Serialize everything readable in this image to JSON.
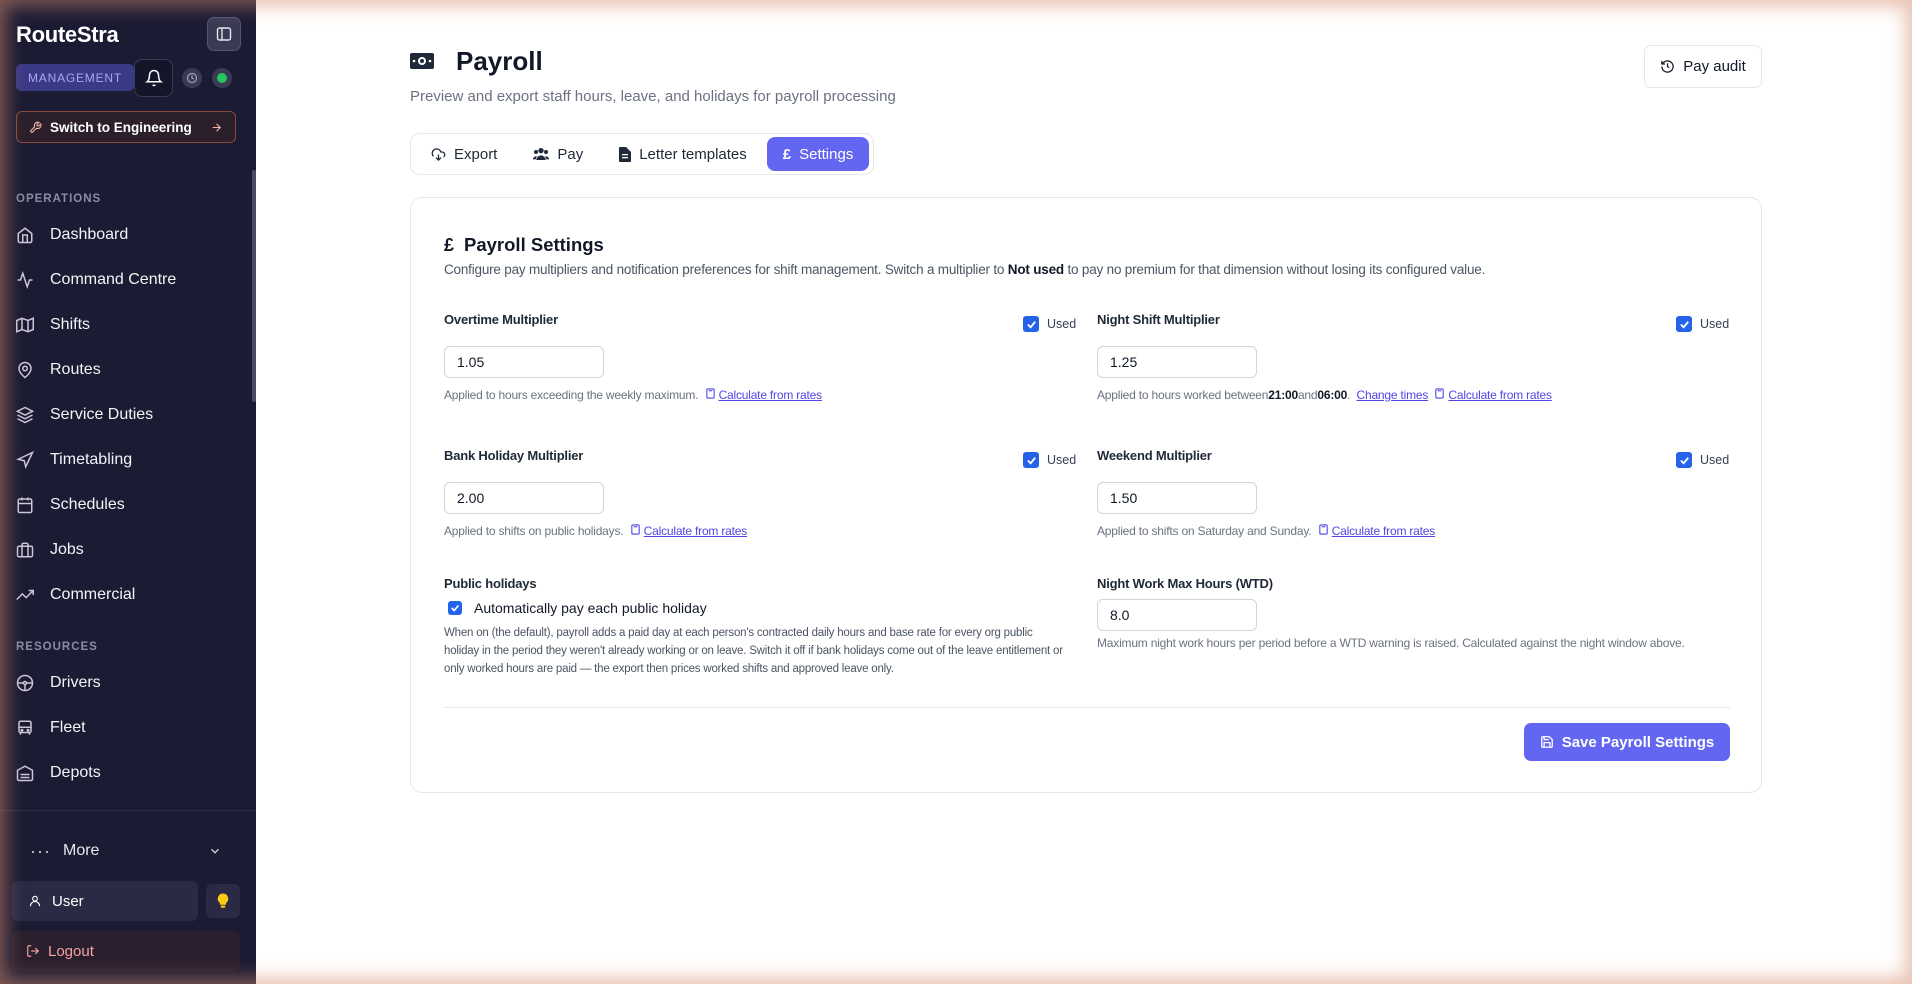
{
  "app": {
    "brand": "RouteStra",
    "role_badge": "MANAGEMENT"
  },
  "sidebar": {
    "switch_label": "Switch to Engineering",
    "sections": [
      {
        "label": "OPERATIONS"
      },
      {
        "label": "RESOURCES"
      }
    ],
    "items": [
      {
        "label": "Dashboard",
        "icon": "home-icon"
      },
      {
        "label": "Command Centre",
        "icon": "activity-icon"
      },
      {
        "label": "Shifts",
        "icon": "map-icon"
      },
      {
        "label": "Routes",
        "icon": "map-pin-icon"
      },
      {
        "label": "Service Duties",
        "icon": "layers-icon"
      },
      {
        "label": "Timetabling",
        "icon": "navigation-icon"
      },
      {
        "label": "Schedules",
        "icon": "calendar-icon"
      },
      {
        "label": "Jobs",
        "icon": "briefcase-icon"
      },
      {
        "label": "Commercial",
        "icon": "trending-up-icon"
      },
      {
        "label": "Drivers",
        "icon": "steering-wheel-icon"
      },
      {
        "label": "Fleet",
        "icon": "bus-icon"
      },
      {
        "label": "Depots",
        "icon": "warehouse-icon"
      }
    ],
    "more_label": "More",
    "user_label": "User",
    "logout_label": "Logout"
  },
  "header": {
    "title": "Payroll",
    "subtitle": "Preview and export staff hours, leave, and holidays for payroll processing",
    "audit_label": "Pay audit"
  },
  "tabs": [
    {
      "label": "Export",
      "icon": "cloud-download-icon"
    },
    {
      "label": "Pay",
      "icon": "users-icon"
    },
    {
      "label": "Letter templates",
      "icon": "file-icon"
    },
    {
      "label": "Settings",
      "icon": "pound-icon",
      "active": true
    }
  ],
  "settings": {
    "title": "Payroll Settings",
    "desc_before": "Configure pay multipliers and notification preferences for shift management. Switch a multiplier to ",
    "desc_bold": "Not used",
    "desc_after": " to pay no premium for that dimension without losing its configured value.",
    "used_label": "Used",
    "calc_label": "Calculate from rates",
    "overtime": {
      "label": "Overtime Multiplier",
      "value": "1.05",
      "used": true,
      "help": "Applied to hours exceeding the weekly maximum."
    },
    "night_shift": {
      "label": "Night Shift Multiplier",
      "value": "1.25",
      "used": true,
      "help_before": "Applied to hours worked between ",
      "start": "21:00",
      "and": " and ",
      "end": "06:00",
      "help_after": ".",
      "change_times": "Change times"
    },
    "bank_holiday": {
      "label": "Bank Holiday Multiplier",
      "value": "2.00",
      "used": true,
      "help": "Applied to shifts on public holidays."
    },
    "weekend": {
      "label": "Weekend Multiplier",
      "value": "1.50",
      "used": true,
      "help": "Applied to shifts on Saturday and Sunday."
    },
    "public_holidays": {
      "label": "Public holidays",
      "checkbox_label": "Automatically pay each public holiday",
      "checked": true,
      "help": "When on (the default), payroll adds a paid day at each person's contracted daily hours and base rate for every org public holiday in the period they weren't already working or on leave. Switch it off if bank holidays come out of the leave entitlement or only worked hours are paid — the export then prices worked shifts and approved leave only."
    },
    "night_work": {
      "label": "Night Work Max Hours (WTD)",
      "value": "8.0",
      "help": "Maximum night work hours per period before a WTD warning is raised. Calculated against the night window above."
    },
    "save_label": "Save Payroll Settings"
  },
  "colors": {
    "accent": "#6366f1",
    "sidebar_bg": "#1b1b33",
    "checkbox": "#2563eb",
    "online": "#22c55e"
  }
}
